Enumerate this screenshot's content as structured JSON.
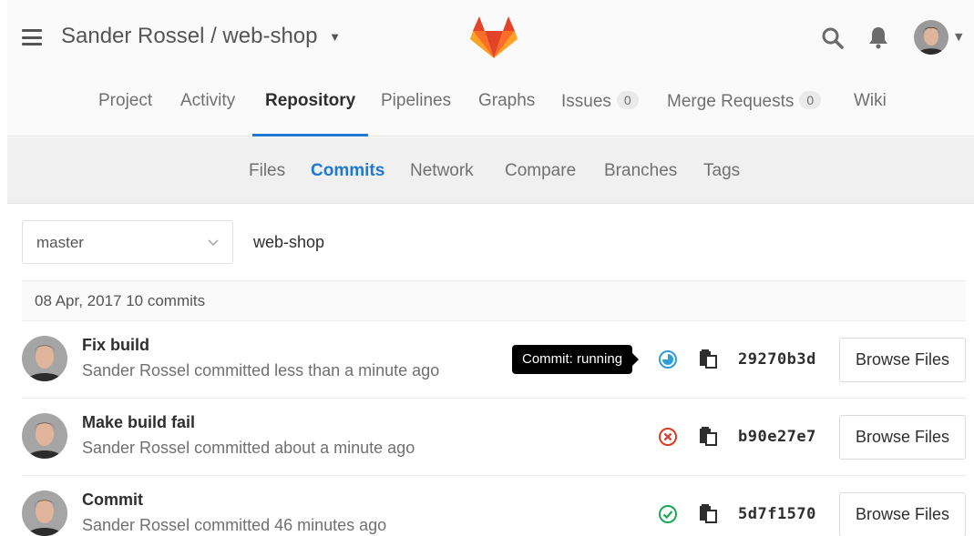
{
  "header": {
    "title": "Sander Rossel / web-shop",
    "icons": [
      "hamburger-icon",
      "gitlab-logo",
      "search-icon",
      "bell-icon",
      "avatar",
      "chevron-down-icon"
    ]
  },
  "nav": {
    "tabs": [
      {
        "label": "Project"
      },
      {
        "label": "Activity"
      },
      {
        "label": "Repository",
        "active": true
      },
      {
        "label": "Pipelines"
      },
      {
        "label": "Graphs"
      },
      {
        "label": "Issues",
        "badge": "0"
      },
      {
        "label": "Merge Requests",
        "badge": "0"
      },
      {
        "label": "Wiki"
      }
    ]
  },
  "subnav": {
    "tabs": [
      {
        "label": "Files"
      },
      {
        "label": "Commits",
        "active": true
      },
      {
        "label": "Network"
      },
      {
        "label": "Compare"
      },
      {
        "label": "Branches"
      },
      {
        "label": "Tags"
      }
    ]
  },
  "branch": {
    "selected": "master",
    "repo": "web-shop"
  },
  "day_header": "08 Apr, 2017 10 commits",
  "tooltip": "Commit: running",
  "commits": [
    {
      "title": "Fix build",
      "meta": "Sander Rossel committed less than a minute ago",
      "status": "running",
      "status_color": "#2d9fd8",
      "sha": "29270b3d",
      "browse": "Browse Files"
    },
    {
      "title": "Make build fail",
      "meta": "Sander Rossel committed about a minute ago",
      "status": "failed",
      "status_color": "#db3b21",
      "sha": "b90e27e7",
      "browse": "Browse Files"
    },
    {
      "title": "Commit",
      "meta": "Sander Rossel committed 46 minutes ago",
      "status": "passed",
      "status_color": "#1aaa55",
      "sha": "5d7f1570",
      "browse": "Browse Files"
    }
  ],
  "colors": {
    "accent": "#1f78d1",
    "running": "#2d9fd8",
    "failed": "#db3b21",
    "passed": "#1aaa55",
    "logo_orange": "#fc6d26"
  }
}
